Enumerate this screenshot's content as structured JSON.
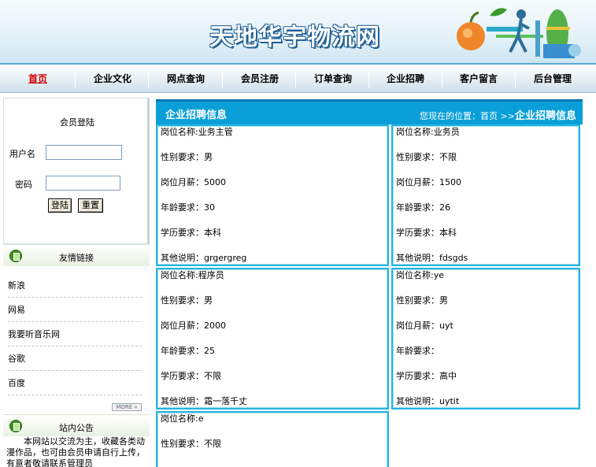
{
  "site": {
    "title": "天地华宇物流网"
  },
  "nav": {
    "items": [
      "首页",
      "企业文化",
      "网点查询",
      "会员注册",
      "订单查询",
      "企业招聘",
      "客户留言",
      "后台管理"
    ]
  },
  "login": {
    "title": "会员登陆",
    "username_label": "用户名",
    "username_value": "",
    "password_label": "密码",
    "password_value": "",
    "login_button": "登陆",
    "reset_button": "重置"
  },
  "links": {
    "title": "友情链接",
    "items": [
      "新浪",
      "网易",
      "我要听音乐网",
      "谷歌",
      "百度"
    ],
    "more": "MORE »"
  },
  "notice": {
    "title": "站内公告",
    "text": "本网站以交流为主，收藏各类动漫作品，也可由会员申请自行上传，有意者敬请联系管理员"
  },
  "main": {
    "title": "企业招聘信息",
    "breadcrumb_prefix": "您现在的位置：首页 >>",
    "breadcrumb_current": "企业招聘信息"
  },
  "jobs": [
    {
      "name": "岗位名称:业务主管",
      "gender": "性别要求：男",
      "salary": "岗位月薪：5000",
      "age": "年龄要求：30",
      "edu": "学历要求：本科",
      "note": "其他说明：grgergreg"
    },
    {
      "name": "岗位名称:业务员",
      "gender": "性别要求：不限",
      "salary": "岗位月薪：1500",
      "age": "年龄要求：26",
      "edu": "学历要求：本科",
      "note": "其他说明：fdsgds"
    },
    {
      "name": "岗位名称:程序员",
      "gender": "性别要求：男",
      "salary": "岗位月薪：2000",
      "age": "年龄要求：25",
      "edu": "学历要求：不限",
      "note": "其他说明：霜一落千丈"
    },
    {
      "name": "岗位名称:ye",
      "gender": "性别要求：男",
      "salary": "岗位月薪：uyt",
      "age": "年龄要求：",
      "edu": "学历要求：高中",
      "note": "其他说明：uytit"
    },
    {
      "name": "岗位名称:e",
      "gender": "性别要求：不限",
      "salary": "",
      "age": "",
      "edu": "",
      "note": ""
    }
  ]
}
